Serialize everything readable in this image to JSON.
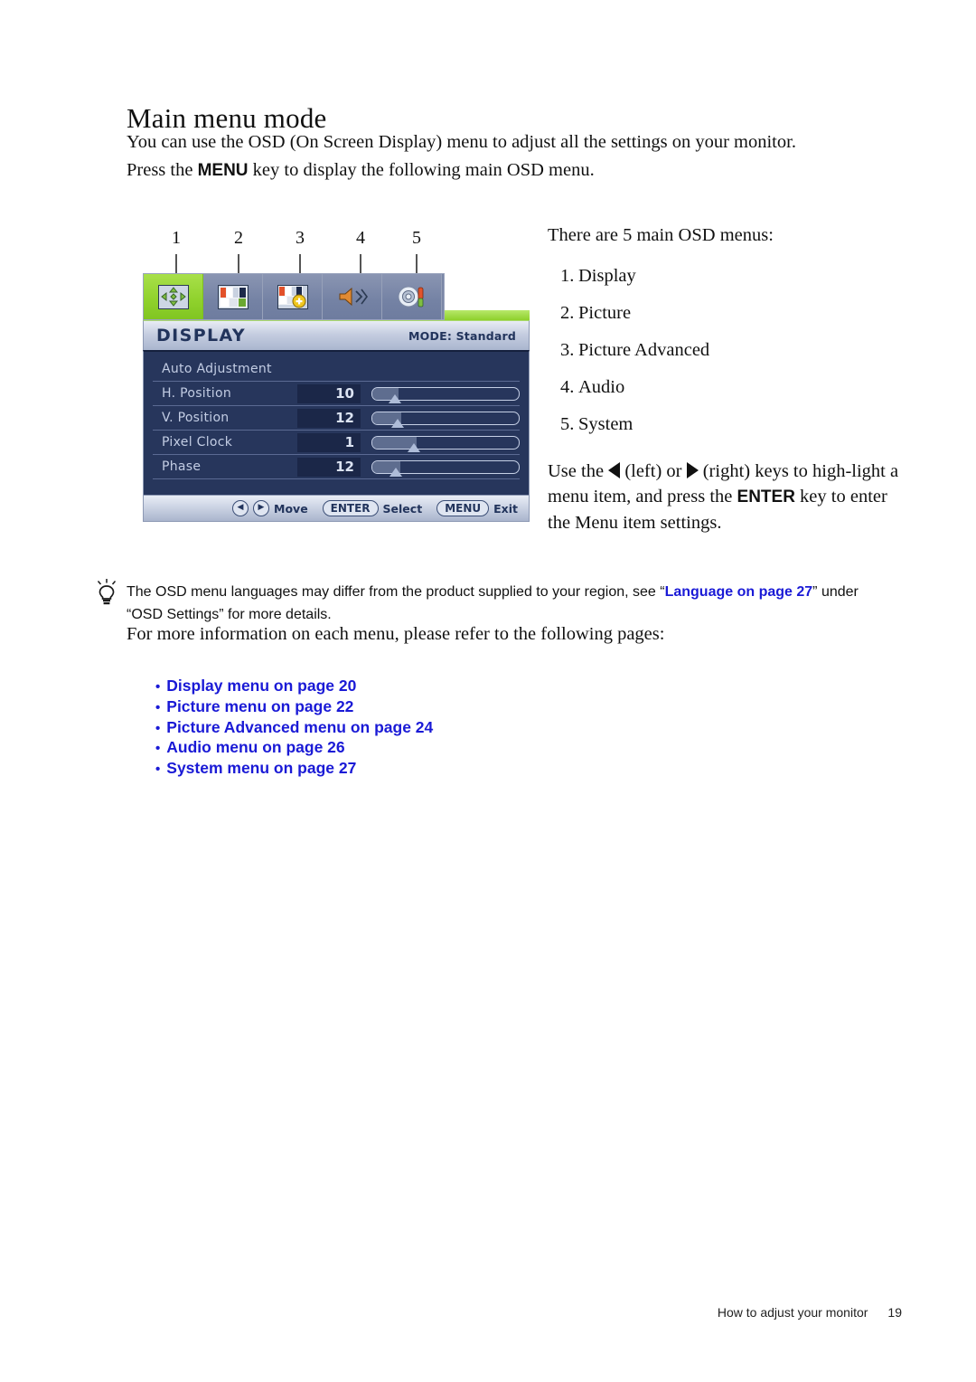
{
  "page": {
    "title": "Main menu mode",
    "intro_line1": "You can use the OSD (On Screen Display) menu to adjust all the settings on your monitor.",
    "intro_line2_before": "Press the ",
    "intro_key": "MENU",
    "intro_line2_after": " key to display the following main OSD menu."
  },
  "callouts": [
    {
      "label": "1"
    },
    {
      "label": "2"
    },
    {
      "label": "3"
    },
    {
      "label": "4"
    },
    {
      "label": "5"
    }
  ],
  "osd": {
    "title": "DISPLAY",
    "mode": "MODE: Standard",
    "tabs": [
      {
        "name": "display-icon",
        "label": "Display"
      },
      {
        "name": "picture-icon",
        "label": "Picture"
      },
      {
        "name": "picture-advanced-icon",
        "label": "Picture Advanced"
      },
      {
        "name": "audio-icon",
        "label": "Audio"
      },
      {
        "name": "system-icon",
        "label": "System"
      }
    ],
    "rows": [
      {
        "label": "Auto Adjustment",
        "value": "",
        "slider": null
      },
      {
        "label": "H. Position",
        "value": "10",
        "slider": 18
      },
      {
        "label": "V. Position",
        "value": "12",
        "slider": 20
      },
      {
        "label": "Pixel Clock",
        "value": "1",
        "slider": 33
      },
      {
        "label": "Phase",
        "value": "12",
        "slider": 20
      }
    ],
    "footer": {
      "move_label": "Move",
      "enter_key": "ENTER",
      "select_label": "Select",
      "menu_key": "MENU",
      "exit_label": "Exit",
      "left_glyph": "◀",
      "right_glyph": "▶"
    },
    "colors": {
      "active_tab": "#8fd12c",
      "body_bg": "#27365c",
      "title_text": "#22345c"
    }
  },
  "right_column": {
    "intro": "There are 5 main OSD menus:",
    "menus": [
      {
        "num": "1.",
        "label": "Display"
      },
      {
        "num": "2.",
        "label": "Picture"
      },
      {
        "num": "3.",
        "label": "Picture Advanced"
      },
      {
        "num": "4.",
        "label": "Audio"
      },
      {
        "num": "5.",
        "label": "System"
      }
    ],
    "keys_p1": "Use the ",
    "keys_p2": " (left) or ",
    "keys_p3": " (right) keys to high-light a menu item, and press the ",
    "keys_enter": "ENTER",
    "keys_p4": " key to enter the Menu item settings."
  },
  "note": {
    "text_before": "The OSD menu languages may differ from the product supplied to your region, see “",
    "link_text": "Language on page 27",
    "text_after": "” under “OSD Settings” for more details.",
    "link_color": "#1a1ad6"
  },
  "more_info": "For more information on each menu, please refer to the following pages:",
  "links": [
    {
      "label": "Display menu on page 20"
    },
    {
      "label": "Picture menu on page 22"
    },
    {
      "label": "Picture Advanced menu on page 24"
    },
    {
      "label": "Audio menu on page 26"
    },
    {
      "label": "System menu on page 27"
    }
  ],
  "footer": {
    "section": "How to adjust your monitor",
    "page_number": "19"
  }
}
